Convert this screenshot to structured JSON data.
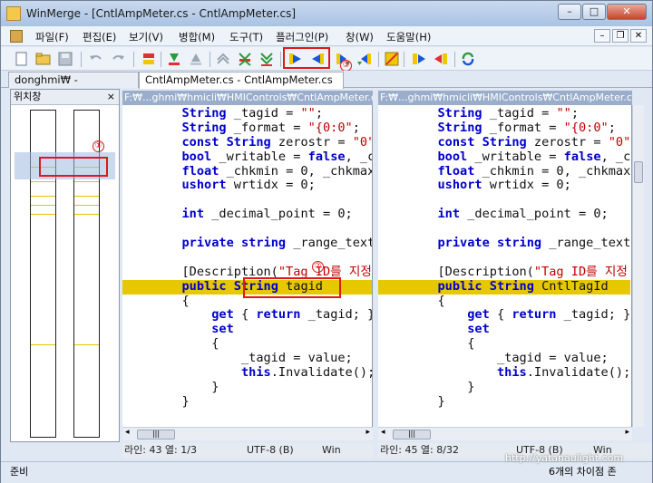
{
  "window": {
    "title": "WinMerge - [CntlAmpMeter.cs - CntlAmpMeter.cs]"
  },
  "menu": [
    "파일(F)",
    "편집(E)",
    "보기(V)",
    "병합(M)",
    "도구(T)",
    "플러그인(P)",
    "창(W)",
    "도움말(H)"
  ],
  "tabs": [
    "donghmi₩ - donghmi₩",
    "CntlAmpMeter.cs - CntlAmpMeter.cs"
  ],
  "location_pane": {
    "title": "위치창",
    "close": "×"
  },
  "left": {
    "path": "F:₩...ghmi₩hmicli₩HMIControls₩CntlAmpMeter.cs",
    "status": {
      "pos": "라인: 43  열: 1/3",
      "enc": "UTF-8 (B)",
      "eol": "Win"
    }
  },
  "right": {
    "path": "F:₩...ghmi₩hmicli₩HMIControls₩CntlAmpMeter.cs",
    "status": {
      "pos": "라인: 45  열: 8/32",
      "enc": "UTF-8 (B)",
      "eol": "Win"
    }
  },
  "code_left": [
    "        String _tagid = \"\";",
    "        String _format = \"{0:0\";",
    "        const String zerostr = \"0\"",
    "        bool _writable = false, _c",
    "        float _chkmin = 0, _chkmax",
    "        ushort wrtidx = 0;",
    "",
    "        int _decimal_point = 0;",
    "",
    "        private string _range_text",
    "",
    "        [Description(\"Tag ID를 지정",
    "        public String tagid",
    "        {",
    "            get { return _tagid; }",
    "            set",
    "            {",
    "                _tagid = value;",
    "                this.Invalidate();",
    "            }",
    "        }"
  ],
  "code_right": [
    "        String _tagid = \"\";",
    "        String _format = \"{0:0\";",
    "        const String zerostr = \"0\"",
    "        bool _writable = false, _c",
    "        float _chkmin = 0, _chkmax",
    "        ushort wrtidx = 0;",
    "",
    "        int _decimal_point = 0;",
    "",
    "        private string _range_text",
    "",
    "        [Description(\"Tag ID를 지정",
    "        public String CntlTagId",
    "        {",
    "            get { return _tagid; }",
    "            set",
    "            {",
    "                _tagid = value;",
    "                this.Invalidate();",
    "            }",
    "        }"
  ],
  "highlight_line_index": 12,
  "annotations": [
    "①",
    "②",
    "③"
  ],
  "statusbar": {
    "left": "준비",
    "right": "6개의 차이점 존"
  },
  "watermark": "http://yatanaulight.com",
  "colors": {
    "diff": "#e6c800",
    "keyword": "#0000cc",
    "string": "#c00000",
    "annotation": "#e01818"
  }
}
